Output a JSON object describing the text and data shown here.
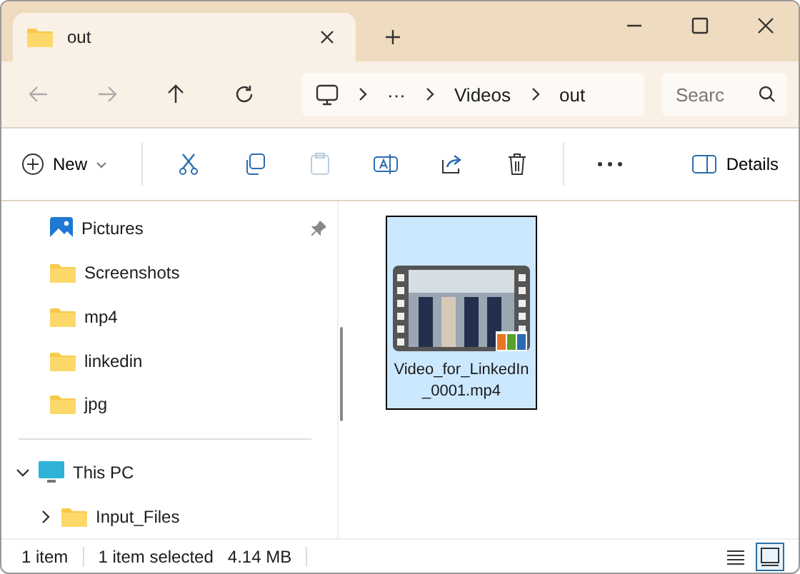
{
  "tab": {
    "title": "out"
  },
  "address": {
    "crumbs": [
      "···",
      "Videos",
      "out"
    ]
  },
  "search": {
    "placeholder": "Searc"
  },
  "toolbar": {
    "new_label": "New",
    "details_label": "Details"
  },
  "sidebar": {
    "items": [
      {
        "label": "Pictures",
        "kind": "pictures",
        "pinned": true
      },
      {
        "label": "Screenshots",
        "kind": "folder",
        "pinned": false
      },
      {
        "label": "mp4",
        "kind": "folder",
        "pinned": false
      },
      {
        "label": "linkedin",
        "kind": "folder",
        "pinned": false
      },
      {
        "label": "jpg",
        "kind": "folder",
        "pinned": false
      }
    ],
    "tree": [
      {
        "label": "This PC",
        "kind": "pc",
        "expanded": true,
        "children": [
          {
            "label": "Input_Files",
            "kind": "folder",
            "expanded": false
          }
        ]
      }
    ]
  },
  "files": [
    {
      "name": "Video_for_LinkedIn_0001.mp4",
      "selected": true
    }
  ],
  "status_bar": {
    "count": "1 item",
    "selection": "1 item selected",
    "size": "4.14 MB"
  },
  "views": [
    {
      "kind": "details",
      "selected": false
    },
    {
      "kind": "large-icons",
      "selected": true
    }
  ]
}
